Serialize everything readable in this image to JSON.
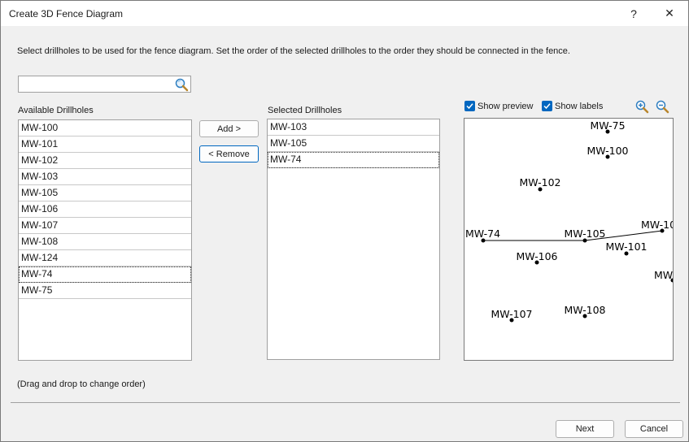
{
  "window": {
    "title": "Create 3D Fence Diagram",
    "help_glyph": "?",
    "close_glyph": "✕"
  },
  "instructions": "Select drillholes to be used for the fence diagram. Set the order of the selected drillholes to the order they should be connected in the fence.",
  "search": {
    "value": "",
    "placeholder": ""
  },
  "available": {
    "label": "Available Drillholes",
    "items": [
      "MW-100",
      "MW-101",
      "MW-102",
      "MW-103",
      "MW-105",
      "MW-106",
      "MW-107",
      "MW-108",
      "MW-124",
      "MW-74",
      "MW-75"
    ]
  },
  "selected": {
    "label": "Selected Drillholes",
    "items": [
      "MW-103",
      "MW-105",
      "MW-74"
    ]
  },
  "buttons": {
    "add": "Add >",
    "remove": "< Remove",
    "next": "Next",
    "cancel": "Cancel"
  },
  "preview_options": {
    "show_preview": "Show preview",
    "show_preview_checked": true,
    "show_labels": "Show labels",
    "show_labels_checked": true
  },
  "preview": {
    "labels": {
      "mw75": "MW-75",
      "mw100": "MW-100",
      "mw102": "MW-102",
      "mw74": "MW-74",
      "mw105": "MW-105",
      "mw103": "MW-10",
      "mw101": "MW-101",
      "mw106": "MW-106",
      "mw124": "MW",
      "mw107": "MW-107",
      "mw108": "MW-108"
    }
  },
  "hint": "(Drag and drop to change order)",
  "colors": {
    "accent": "#0067c0",
    "border": "#a0a0a0"
  },
  "icons": [
    "search-icon",
    "zoom-in-icon",
    "zoom-out-icon",
    "help-icon",
    "close-icon",
    "checkmark-icon"
  ]
}
